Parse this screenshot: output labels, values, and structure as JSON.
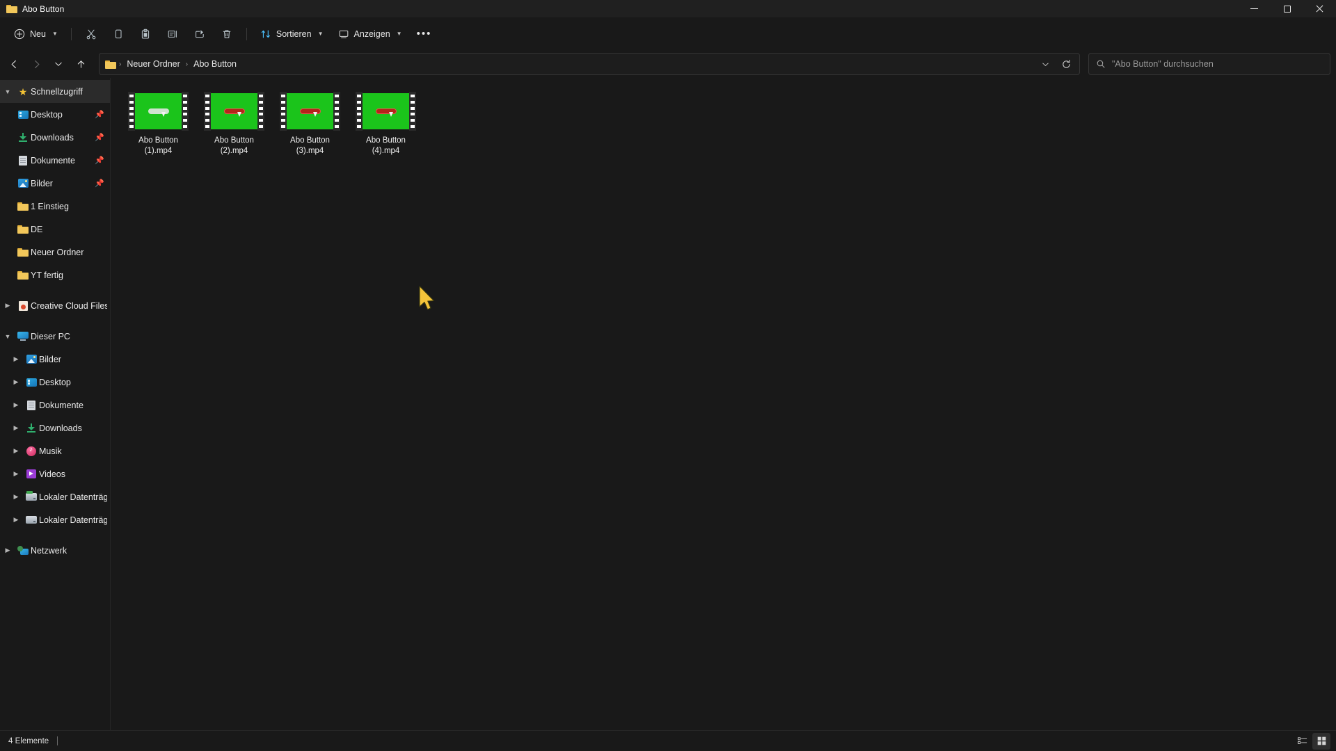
{
  "window": {
    "title": "Abo Button",
    "folder_icon": "folder-icon",
    "controls": {
      "minimize": "minimize-button",
      "maximize": "maximize-button",
      "close": "close-button"
    }
  },
  "toolbar": {
    "new_label": "Neu",
    "new_icon": "plus-circle-icon",
    "cut_icon": "scissors-icon",
    "copy_icon": "copy-icon",
    "paste_icon": "clipboard-icon",
    "rename_icon": "rename-icon",
    "share_icon": "share-icon",
    "delete_icon": "trash-icon",
    "sort_label": "Sortieren",
    "sort_icon": "sort-arrows-icon",
    "view_label": "Anzeigen",
    "view_icon": "monitor-icon",
    "more_label": "•••"
  },
  "addressbar": {
    "back_icon": "arrow-left-icon",
    "forward_icon": "arrow-right-icon",
    "recent_icon": "chevron-down-icon",
    "up_icon": "arrow-up-icon",
    "breadcrumb": [
      "Neuer Ordner",
      "Abo Button"
    ],
    "separator": "›",
    "dropdown_icon": "chevron-down-icon",
    "refresh_icon": "refresh-icon"
  },
  "search": {
    "placeholder": "\"Abo Button\" durchsuchen",
    "icon": "search-icon"
  },
  "sidebar": {
    "quick_access": {
      "label": "Schnellzugriff",
      "icon": "star-icon",
      "expanded": true,
      "items": [
        {
          "label": "Desktop",
          "icon": "desktop-icon",
          "pinned": true
        },
        {
          "label": "Downloads",
          "icon": "download-icon",
          "pinned": true
        },
        {
          "label": "Dokumente",
          "icon": "document-icon",
          "pinned": true
        },
        {
          "label": "Bilder",
          "icon": "pictures-icon",
          "pinned": true
        },
        {
          "label": "1 Einstieg",
          "icon": "folder-icon",
          "pinned": false
        },
        {
          "label": "DE",
          "icon": "folder-icon",
          "pinned": false
        },
        {
          "label": "Neuer Ordner",
          "icon": "folder-icon",
          "pinned": false
        },
        {
          "label": "YT fertig",
          "icon": "folder-icon",
          "pinned": false
        }
      ]
    },
    "creative_cloud": {
      "label": "Creative Cloud Files",
      "icon": "creative-cloud-icon",
      "expanded": false
    },
    "this_pc": {
      "label": "Dieser PC",
      "icon": "pc-icon",
      "expanded": true,
      "items": [
        {
          "label": "Bilder",
          "icon": "pictures-icon"
        },
        {
          "label": "Desktop",
          "icon": "desktop-icon"
        },
        {
          "label": "Dokumente",
          "icon": "document-icon"
        },
        {
          "label": "Downloads",
          "icon": "download-icon"
        },
        {
          "label": "Musik",
          "icon": "music-icon"
        },
        {
          "label": "Videos",
          "icon": "video-icon"
        },
        {
          "label": "Lokaler Datenträge",
          "icon": "system-drive-icon"
        },
        {
          "label": "Lokaler Datenträge",
          "icon": "drive-icon"
        }
      ]
    },
    "network": {
      "label": "Netzwerk",
      "icon": "network-icon",
      "expanded": false
    }
  },
  "files": [
    {
      "name": "Abo Button (1).mp4",
      "line1": "Abo Button",
      "line2": "(1).mp4",
      "thumb_button_color": "#cfe3cf",
      "thumb_bg": "#1bc41b"
    },
    {
      "name": "Abo Button (2).mp4",
      "line1": "Abo Button",
      "line2": "(2).mp4",
      "thumb_button_color": "#b4241b",
      "thumb_bg": "#1bc41b"
    },
    {
      "name": "Abo Button (3).mp4",
      "line1": "Abo Button",
      "line2": "(3).mp4",
      "thumb_button_color": "#b4241b",
      "thumb_bg": "#1bc41b"
    },
    {
      "name": "Abo Button (4).mp4",
      "line1": "Abo Button",
      "line2": "(4).mp4",
      "thumb_button_color": "#b4241b",
      "thumb_bg": "#1bc41b"
    }
  ],
  "statusbar": {
    "count_text": "4 Elemente",
    "details_view_icon": "details-view-icon",
    "large_icons_view_icon": "large-icons-view-icon"
  },
  "colors": {
    "window_bg": "#191919",
    "titlebar_bg": "#202020",
    "accent": "#4cc2ff",
    "folder_yellow": "#f2c75a",
    "thumb_green": "#1bc41b",
    "cursor": "#f5c43a"
  }
}
